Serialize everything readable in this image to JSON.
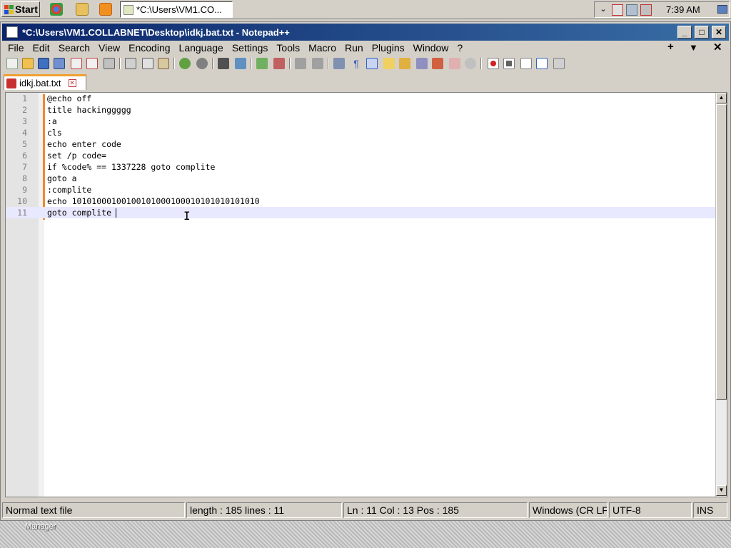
{
  "taskbar": {
    "start_label": "Start",
    "task_title": "*C:\\Users\\VM1.CO...",
    "clock": "7:39 AM"
  },
  "window": {
    "title": "*C:\\Users\\VM1.COLLABNET\\Desktop\\idkj.bat.txt - Notepad++",
    "controls": {
      "minimize": "_",
      "maximize": "□",
      "close": "✕"
    }
  },
  "menu": {
    "items": [
      "File",
      "Edit",
      "Search",
      "View",
      "Encoding",
      "Language",
      "Settings",
      "Tools",
      "Macro",
      "Run",
      "Plugins",
      "Window",
      "?"
    ],
    "right": {
      "plus": "+",
      "dropdown": "▼",
      "close": "✕"
    }
  },
  "tab": {
    "label": "idkj.bat.txt",
    "close": "✕"
  },
  "editor": {
    "lines": [
      {
        "num": "1",
        "text": "@echo off"
      },
      {
        "num": "2",
        "text": "title hackinggggg"
      },
      {
        "num": "3",
        "text": ":a"
      },
      {
        "num": "4",
        "text": "cls"
      },
      {
        "num": "5",
        "text": "echo enter code"
      },
      {
        "num": "6",
        "text": "set /p code="
      },
      {
        "num": "7",
        "text": "if %code% == 1337228 goto complite"
      },
      {
        "num": "8",
        "text": "goto a"
      },
      {
        "num": "9",
        "text": ":complite"
      },
      {
        "num": "10",
        "text": "echo 10101000100100101000100010101010101010"
      },
      {
        "num": "11",
        "text": "goto complite"
      }
    ]
  },
  "status": {
    "file_type": "Normal text file",
    "length": "length : 185    lines : 11",
    "position": "Ln : 11    Col : 13    Pos : 185",
    "eol": "Windows (CR LF)",
    "encoding": "UTF-8",
    "mode": "INS"
  },
  "desktop": {
    "label": "Manager"
  },
  "colors": {
    "titlebar": "#0a246a",
    "changebar": "#f08830",
    "current_line": "#e8e8ff"
  }
}
